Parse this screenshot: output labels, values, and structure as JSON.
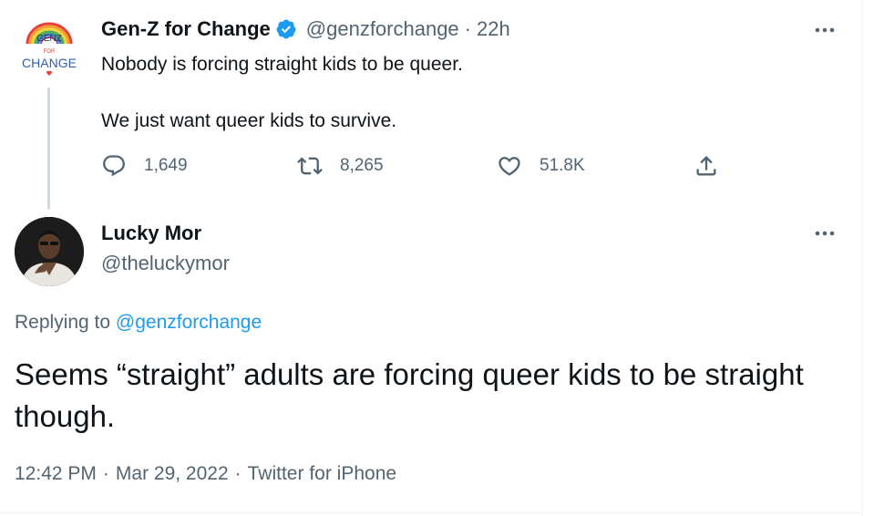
{
  "parent_tweet": {
    "author_name": "Gen-Z for Change",
    "handle": "@genzforchange",
    "separator": "·",
    "time": "22h",
    "avatar_text_top": "GENZ",
    "avatar_text_mid": "FOR",
    "avatar_text_bottom": "CHANGE",
    "text_line_1": "Nobody is forcing straight kids to be queer.",
    "text_line_2": "We just want queer kids to survive.",
    "replies": "1,649",
    "retweets": "8,265",
    "likes": "51.8K",
    "icons": {
      "verified": "verified-badge-icon",
      "reply": "reply-icon",
      "retweet": "retweet-icon",
      "like": "heart-icon",
      "share": "share-icon",
      "more": "more-icon"
    }
  },
  "focal_tweet": {
    "author_name": "Lucky Mor",
    "handle": "@theluckymor",
    "replying_prefix": "Replying to",
    "replying_to": "@genzforchange",
    "text": "Seems “straight” adults are forcing queer kids to be straight though.",
    "time": "12:42 PM",
    "separator": "·",
    "date": "Mar 29, 2022",
    "source": "Twitter for iPhone"
  },
  "colors": {
    "text": "#0f1419",
    "secondary": "#536471",
    "accent": "#1d9bf0",
    "thread_line": "#cfd9de"
  }
}
